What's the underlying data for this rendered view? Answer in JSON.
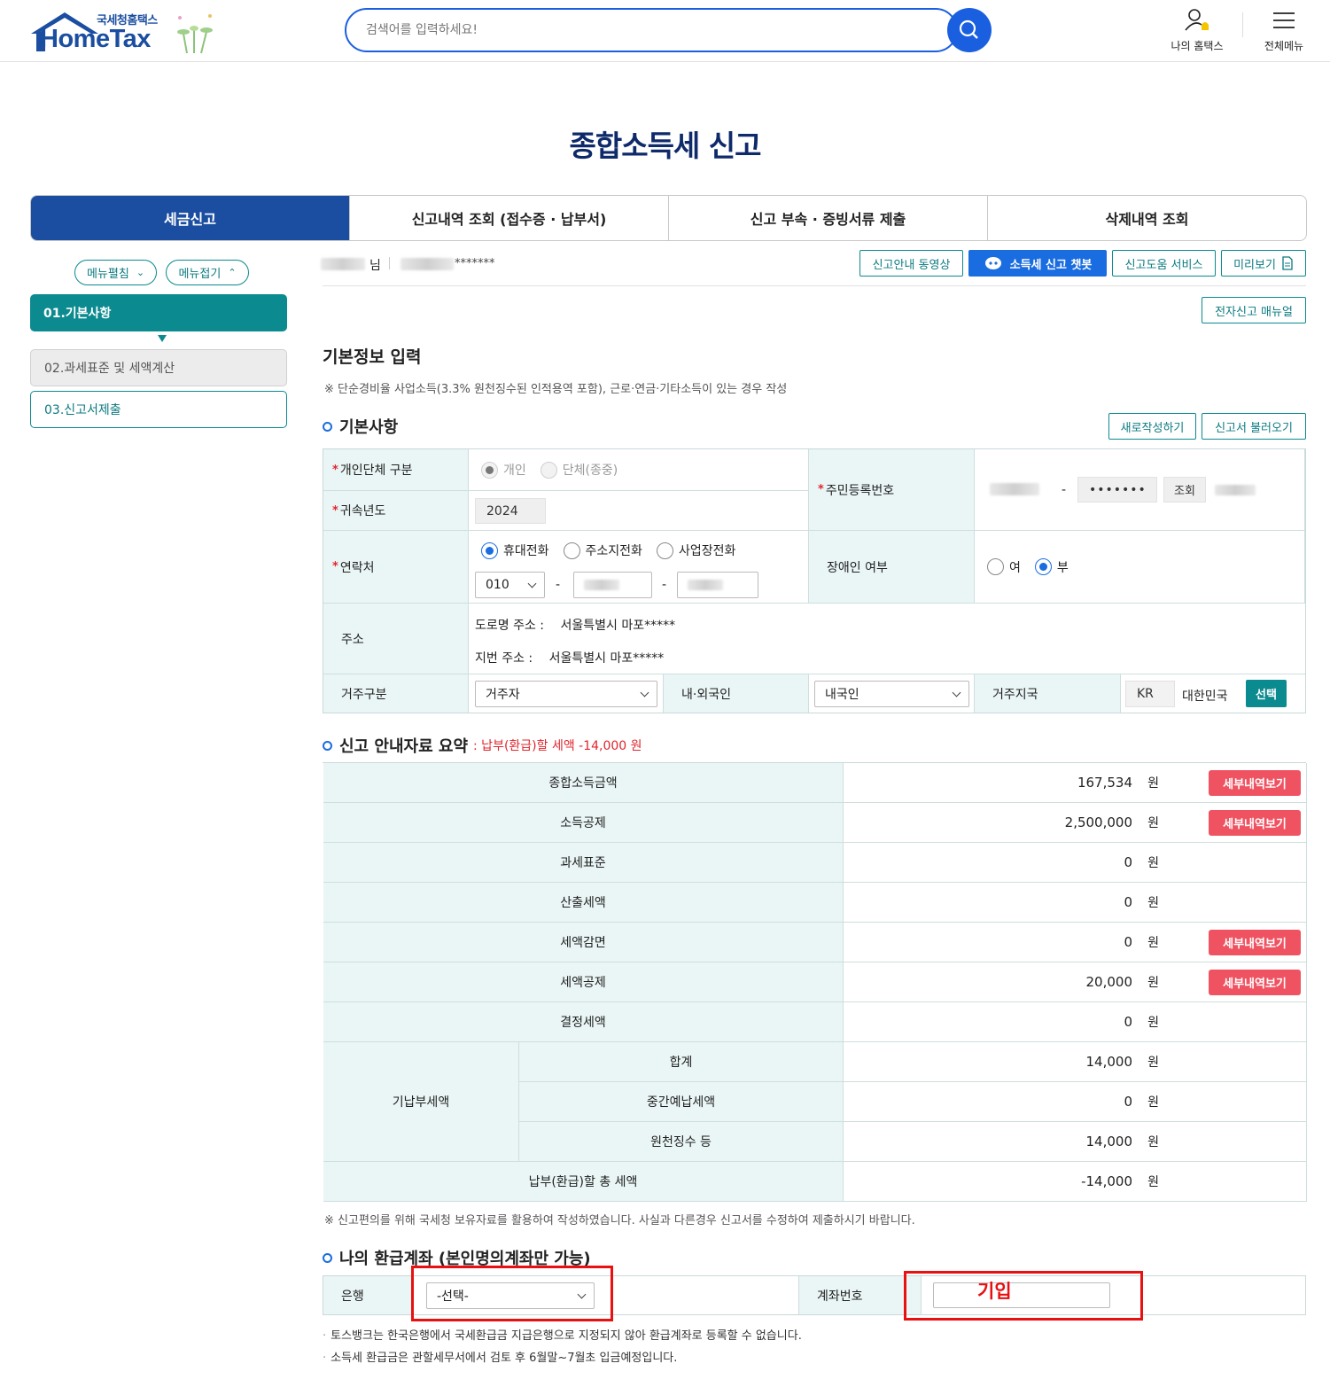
{
  "header": {
    "logo_sub": "국세청홈택스",
    "logo_main": "HomeTax",
    "search_placeholder": "검색어를 입력하세요!",
    "my_hometax": "나의 홈택스",
    "all_menu": "전체메뉴"
  },
  "page_title": "종합소득세 신고",
  "tabs": [
    "세금신고",
    "신고내역 조회 (접수증 · 납부서)",
    "신고 부속 · 증빙서류 제출",
    "삭제내역 조회"
  ],
  "left_nav": {
    "expand": "메뉴펼침",
    "collapse": "메뉴접기",
    "steps": [
      "01.기본사항",
      "02.과세표준 및 세액계산",
      "03.신고서제출"
    ]
  },
  "user": {
    "suffix": "님",
    "masked_id": "*******"
  },
  "top_buttons": [
    "신고안내 동영상",
    "소득세 신고 챗봇",
    "신고도움 서비스",
    "미리보기",
    "전자신고 매뉴얼"
  ],
  "basic_input": {
    "title": "기본정보 입력",
    "note": "※ 단순경비율 사업소득(3.3% 원천징수된 인적용역 포함), 근로·연금·기타소득이 있는 경우 작성"
  },
  "basic_section": {
    "title": "기본사항",
    "new_btn": "새로작성하기",
    "load_btn": "신고서 불러오기",
    "rows": {
      "type_label": "개인단체 구분",
      "type_opts": [
        "개인",
        "단체(종중)"
      ],
      "year_label": "귀속년도",
      "year_value": "2024",
      "rrn_label": "주민등록번호",
      "rrn_masked": "•••••••",
      "rrn_lookup": "조회",
      "contact_label": "연락처",
      "contact_opts": [
        "휴대전화",
        "주소지전화",
        "사업장전화"
      ],
      "phone_prefix": "010",
      "disability_label": "장애인 여부",
      "disability_opts": [
        "여",
        "부"
      ],
      "address_label": "주소",
      "road_label": "도로명 주소 :",
      "road_value": "서울특별시 마포*****",
      "jibun_label": "지번 주소 :",
      "jibun_value": "서울특별시 마포*****",
      "residency_label": "거주구분",
      "residency_value": "거주자",
      "nationality_label": "내·외국인",
      "nationality_value": "내국인",
      "country_label": "거주지국",
      "country_code": "KR",
      "country_name": "대한민국",
      "select_btn": "선택"
    }
  },
  "summary": {
    "title": "신고 안내자료 요약",
    "subtitle": ": 납부(환급)할 세액 -14,000 원",
    "unit": "원",
    "detail_btn": "세부내역보기",
    "rows": [
      {
        "label": "종합소득금액",
        "value": "167,534"
      },
      {
        "label": "소득공제",
        "value": "2,500,000"
      },
      {
        "label": "과세표준",
        "value": "0"
      },
      {
        "label": "산출세액",
        "value": "0"
      },
      {
        "label": "세액감면",
        "value": "0"
      },
      {
        "label": "세액공제",
        "value": "20,000"
      },
      {
        "label": "결정세액",
        "value": "0"
      }
    ],
    "prepaid_label": "기납부세액",
    "prepaid_rows": [
      {
        "label": "합계",
        "value": "14,000"
      },
      {
        "label": "중간예납세액",
        "value": "0"
      },
      {
        "label": "원천징수 등",
        "value": "14,000"
      }
    ],
    "total_label": "납부(환급)할 총 세액",
    "total_value": "-14,000",
    "note": "※ 신고편의를 위해 국세청 보유자료를 활용하여 작성하였습니다. 사실과 다른경우 신고서를 수정하여 제출하시기 바랍니다."
  },
  "refund": {
    "title": "나의 환급계좌 (본인명의계좌만 가능)",
    "bank_label": "은행",
    "bank_value": "-선택-",
    "account_label": "계좌번호",
    "annotation": "기입",
    "notes": [
      "토스뱅크는 한국은행에서 국세환급금 지급은행으로 지정되지 않아 환급계좌로 등록할 수 없습니다.",
      "소득세 환급금은 관할세무서에서 검토 후 6월말~7월초 입금예정입니다."
    ]
  },
  "colors": {
    "primary": "#1b4ea0",
    "teal": "#0b8a8f",
    "accent_blue": "#1a6de0",
    "red_btn": "#ef5362",
    "annotation_red": "#e81010"
  }
}
